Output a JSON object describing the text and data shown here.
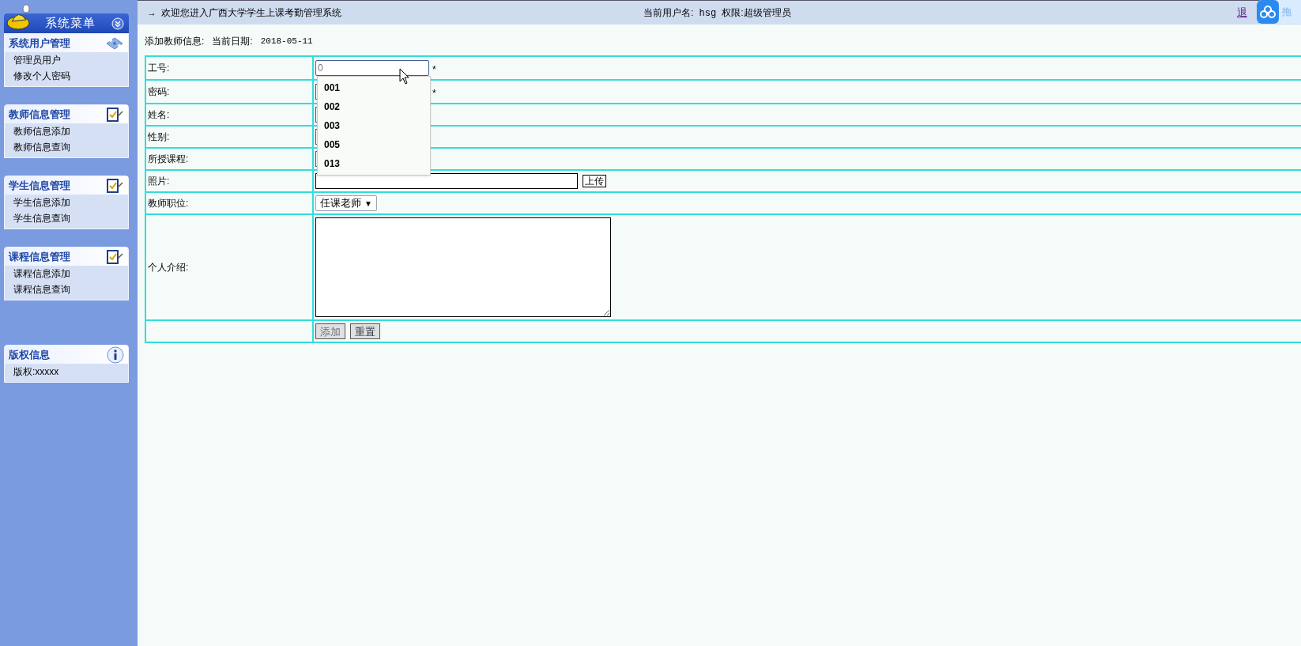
{
  "sidebar": {
    "title": "系统菜单",
    "sections": [
      {
        "title": "系统用户管理",
        "kind": "network",
        "items": [
          "管理员用户",
          "修改个人密码"
        ]
      },
      {
        "title": "教师信息管理",
        "kind": "checklist",
        "items": [
          "教师信息添加",
          "教师信息查询"
        ]
      },
      {
        "title": "学生信息管理",
        "kind": "checklist",
        "items": [
          "学生信息添加",
          "学生信息查询"
        ]
      },
      {
        "title": "课程信息管理",
        "kind": "checklist",
        "items": [
          "课程信息添加",
          "课程信息查询"
        ]
      },
      {
        "title": "版权信息",
        "kind": "info",
        "items": [
          "版权:xxxxx"
        ]
      }
    ]
  },
  "top_bar": {
    "arrow": "→",
    "welcome": "欢迎您进入广西大学学生上课考勤管理系统",
    "user_label": "当前用户名:",
    "user": "hsg",
    "role_label": "权限:",
    "role": "超级管理员",
    "logout": "退"
  },
  "floating_widget": {
    "label": "拖"
  },
  "page": {
    "heading": "添加教师信息:",
    "date_label": "当前日期:",
    "date": "2018-05-11"
  },
  "form": {
    "rows": [
      {
        "label": "工号:",
        "kind": "text",
        "value": "0",
        "required": true,
        "focused": true
      },
      {
        "label": "密码:",
        "kind": "password",
        "required": true,
        "focused": false
      },
      {
        "label": "姓名:",
        "kind": "text",
        "focused": false
      },
      {
        "label": "性别:",
        "kind": "text",
        "focused": false
      },
      {
        "label": "所授课程:",
        "kind": "text",
        "focused": false
      },
      {
        "label": "照片:",
        "kind": "file",
        "button": "上传"
      },
      {
        "label": "教师职位:",
        "kind": "select",
        "value": "任课老师",
        "arrow": "▼"
      },
      {
        "label": "个人介绍:",
        "kind": "textarea"
      },
      {
        "kind": "buttons",
        "buttons": [
          {
            "label": "添加",
            "disabled": true
          },
          {
            "label": "重置",
            "disabled": false
          }
        ]
      }
    ],
    "required_mark": "*",
    "autocomplete": [
      "001",
      "002",
      "003",
      "005",
      "013"
    ]
  }
}
